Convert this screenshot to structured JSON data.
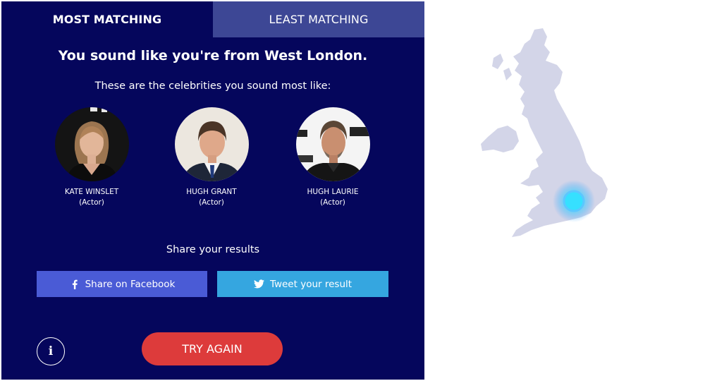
{
  "tabs": {
    "most": "MOST MATCHING",
    "least": "LEAST MATCHING"
  },
  "result": {
    "headline": "You sound like you're from West London.",
    "subhead": "These are the celebrities you sound most like:"
  },
  "celebrities": [
    {
      "name": "KATE WINSLET",
      "role": "(Actor)"
    },
    {
      "name": "HUGH GRANT",
      "role": "(Actor)"
    },
    {
      "name": "HUGH LAURIE",
      "role": "(Actor)"
    }
  ],
  "share": {
    "title": "Share your results",
    "facebook_label": "Share on Facebook",
    "twitter_label": "Tweet your result"
  },
  "actions": {
    "info_symbol": "i",
    "try_again": "TRY AGAIN"
  },
  "icons": {
    "facebook": "facebook-icon",
    "twitter": "twitter-icon",
    "info": "info-icon"
  },
  "colors": {
    "panel_bg": "#05065c",
    "inactive_tab": "#3d4795",
    "facebook": "#4a5bd6",
    "twitter": "#35a6e0",
    "try_again": "#dd3b3b",
    "map_land": "#d3d5e8",
    "map_marker": "#36e0ff"
  }
}
